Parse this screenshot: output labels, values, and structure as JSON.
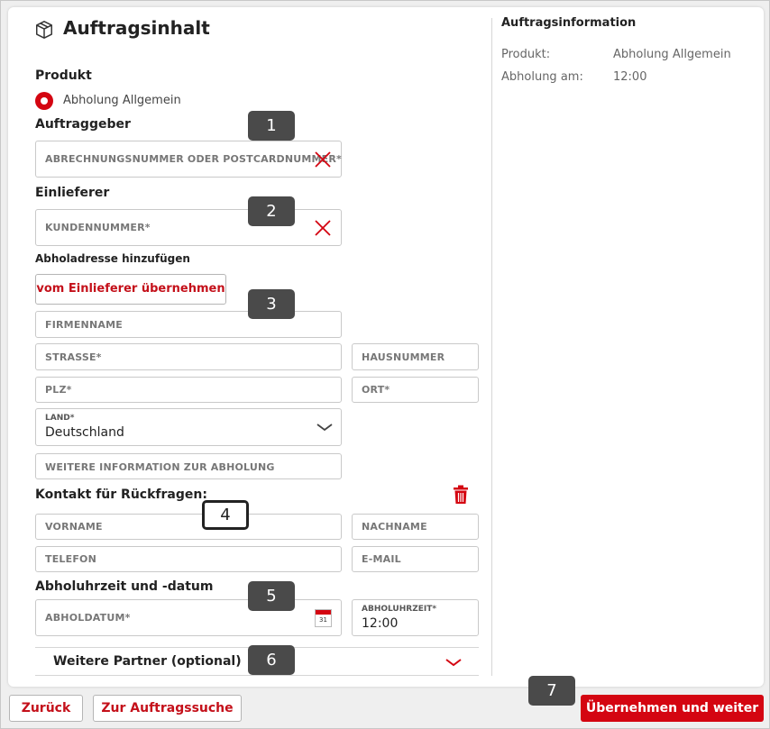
{
  "page": {
    "title": "Auftragsinhalt",
    "product_label": "Produkt",
    "product_option": "Abholung Allgemein",
    "client_label": "Auftraggeber",
    "client_placeholder": "ABRECHNUNGSNUMMER ODER POSTCARDNUMMER*",
    "sender_label": "Einlieferer",
    "sender_placeholder": "KUNDENNUMMER*",
    "pickup_address_label": "Abholadresse hinzufügen",
    "take_from_sender_button": "vom Einlieferer übernehmen",
    "company_placeholder": "FIRMENNAME",
    "street_placeholder": "STRASSE*",
    "house_number_placeholder": "HAUSNUMMER",
    "zip_placeholder": "PLZ*",
    "city_placeholder": "ORT*",
    "country_label": "LAND*",
    "country_value": "Deutschland",
    "more_info_placeholder": "WEITERE INFORMATION ZUR ABHOLUNG",
    "contact_label": "Kontakt für Rückfragen:",
    "first_name_placeholder": "VORNAME",
    "last_name_placeholder": "NACHNAME",
    "phone_placeholder": "TELEFON",
    "email_placeholder": "E-MAIL",
    "pickup_time_label": "Abholuhrzeit und -datum",
    "pickup_date_placeholder": "ABHOLDATUM*",
    "calendar_day": "31",
    "pickup_time_field_label": "ABHOLUHRZEIT*",
    "pickup_time_value": "12:00",
    "more_partners_label": "Weitere Partner (optional)"
  },
  "info": {
    "title": "Auftragsinformation",
    "rows": [
      {
        "key": "Produkt:",
        "value": "Abholung Allgemein"
      },
      {
        "key": "Abholung am:",
        "value": "12:00"
      }
    ]
  },
  "badges": [
    "1",
    "2",
    "3",
    "4",
    "5",
    "6",
    "7"
  ],
  "footer": {
    "back": "Zurück",
    "search": "Zur Auftragssuche",
    "next": "Übernehmen und weiter"
  },
  "colors": {
    "accent": "#d40511",
    "badge": "#4a4a4a"
  },
  "icons": {
    "title": "package-icon",
    "clear": "close-icon",
    "dropdown": "chevron-down-icon",
    "delete": "trash-icon",
    "calendar": "calendar-icon"
  }
}
